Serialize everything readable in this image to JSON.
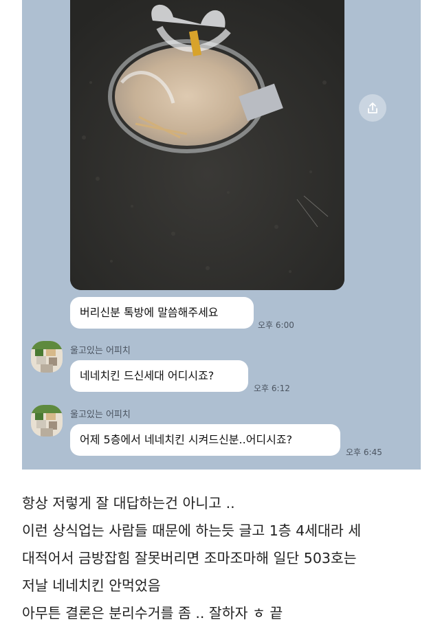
{
  "messages": [
    {
      "text": "버리신분 톡방에 말씀해주세요",
      "time": "오후 6:00"
    },
    {
      "sender": "울고있는 어피치",
      "text": "네네치킨 드신세대 어디시죠?",
      "time": "오후 6:12"
    },
    {
      "sender": "울고있는 어피치",
      "text": "어제 5층에서 네네치킨 시켜드신분..어디시죠?",
      "time": "오후 6:45"
    }
  ],
  "post_lines": [
    "항상 저렇게 잘 대답하는건 아니고 ..",
    "이런 상식업는 사람들 때문에 하는듯 글고 1층 4세대라 세",
    "대적어서 금방잡힘 잘못버리면 조마조마해 일단 503호는",
    "저날 네네치킨 안먹었음",
    "아무튼 결론은 분리수거를 좀 .. 잘하자 ㅎ 끝"
  ],
  "icons": {
    "share": "share-icon",
    "photo": "trash-bag-photo"
  },
  "colors": {
    "chat_background": "#aebfd1",
    "bubble": "#ffffff"
  }
}
